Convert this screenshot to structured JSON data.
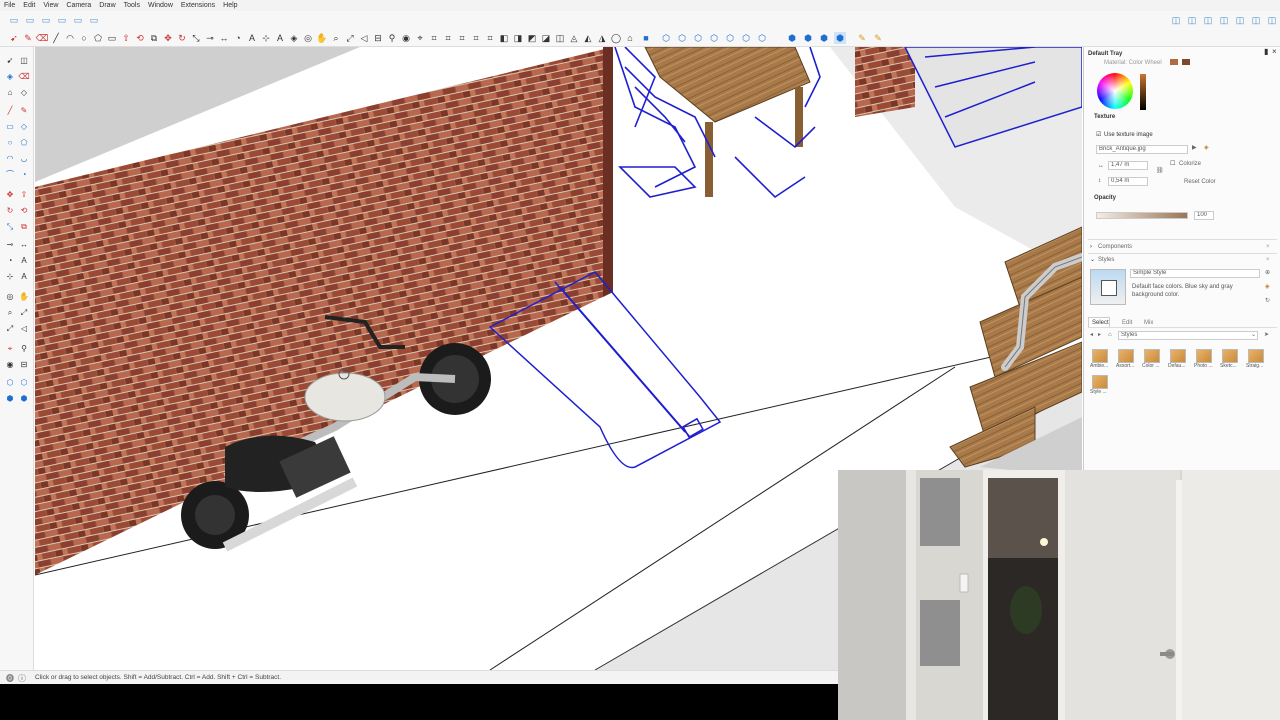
{
  "menu": [
    "File",
    "Edit",
    "View",
    "Camera",
    "Draw",
    "Tools",
    "Window",
    "Extensions",
    "Help"
  ],
  "tray": {
    "title": "Default Tray",
    "color_header": "Material: Color Wheel",
    "texture_heading": "Texture",
    "use_texture_label": "Use texture image",
    "texture_file": "Brick_Antique.jpg",
    "width_value": "1,47 m",
    "height_value": "0,54 m",
    "colorize_label": "Colorize",
    "reset_color_label": "Reset Color",
    "opacity_heading": "Opacity",
    "opacity_value": "100",
    "components_label": "Components",
    "styles_label": "Styles",
    "style_name": "Simple Style",
    "style_desc": "Default face colors. Blue sky and gray background color.",
    "tabs": [
      "Select",
      "Edit",
      "Mix"
    ],
    "styles_dropdown": "Styles",
    "thumbs": [
      "Ambie...",
      "Assort...",
      "Color ...",
      "Defau...",
      "Photo ...",
      "Sketc...",
      "Straig...",
      "Style ..."
    ]
  },
  "status": {
    "message": "Click or drag to select objects. Shift = Add/Subtract. Ctrl = Add. Shift + Ctrl = Subtract."
  },
  "colors": {
    "accent_blue": "#1f1fd0",
    "brick": "#8c3f2e",
    "wood": "#a87a4a"
  }
}
